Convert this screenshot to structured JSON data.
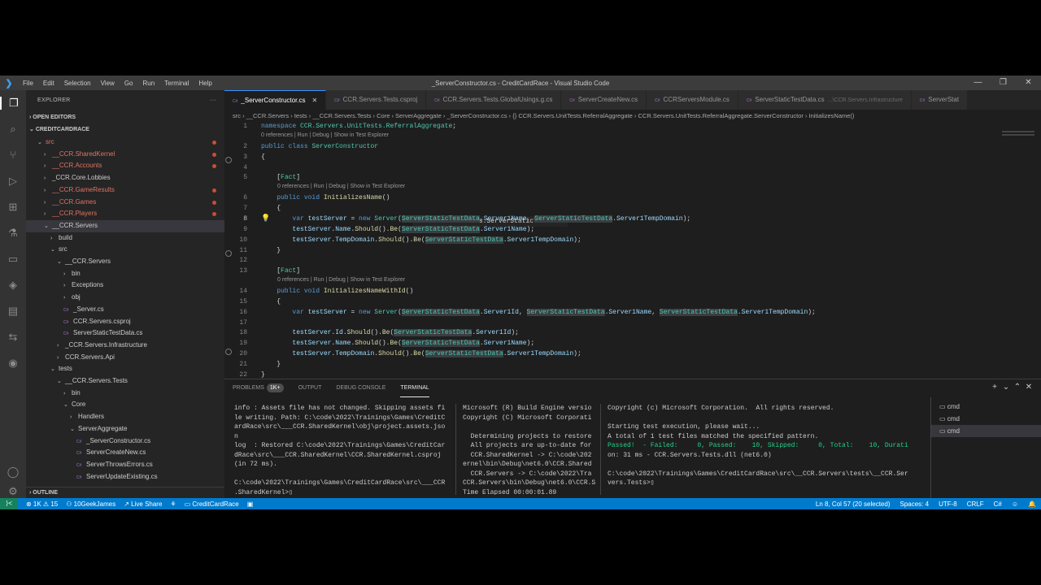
{
  "window": {
    "title": "_ServerConstructor.cs - CreditCardRace - Visual Studio Code",
    "menu": [
      "File",
      "Edit",
      "Selection",
      "View",
      "Go",
      "Run",
      "Terminal",
      "Help"
    ],
    "controls": [
      "—",
      "❐",
      "✕"
    ]
  },
  "sidebar": {
    "title": "EXPLORER",
    "open_editors": "OPEN EDITORS",
    "workspace": "CREDITCARDRACE",
    "outline": "OUTLINE",
    "tree": [
      {
        "label": "src",
        "indent": 1,
        "chev": "⌄",
        "color": "red",
        "dot": true
      },
      {
        "label": "__CCR.SharedKernel",
        "indent": 2,
        "chev": "›",
        "color": "red",
        "dot": true
      },
      {
        "label": "__CCR.Accounts",
        "indent": 2,
        "chev": "›",
        "color": "red",
        "dot": true
      },
      {
        "label": "_CCR.Core.Lobbies",
        "indent": 2,
        "chev": "›",
        "color": "",
        "dot": false
      },
      {
        "label": "__CCR.GameResults",
        "indent": 2,
        "chev": "›",
        "color": "red",
        "dot": true
      },
      {
        "label": "__CCR.Games",
        "indent": 2,
        "chev": "›",
        "color": "red",
        "dot": true
      },
      {
        "label": "__CCR.Players",
        "indent": 2,
        "chev": "›",
        "color": "red",
        "dot": true
      },
      {
        "label": "__CCR.Servers",
        "indent": 2,
        "chev": "⌄",
        "color": "",
        "dot": false,
        "selected": true
      },
      {
        "label": "build",
        "indent": 3,
        "chev": "›",
        "color": "",
        "dot": false
      },
      {
        "label": "src",
        "indent": 3,
        "chev": "⌄",
        "color": "",
        "dot": false
      },
      {
        "label": "__CCR.Servers",
        "indent": 4,
        "chev": "⌄",
        "color": "",
        "dot": false
      },
      {
        "label": "bin",
        "indent": 5,
        "chev": "›",
        "color": "",
        "dot": false
      },
      {
        "label": "Exceptions",
        "indent": 5,
        "chev": "›",
        "color": "",
        "dot": false
      },
      {
        "label": "obj",
        "indent": 5,
        "chev": "›",
        "color": "",
        "dot": false
      },
      {
        "label": "_Server.cs",
        "indent": 5,
        "chev": "",
        "color": "cs",
        "dot": false
      },
      {
        "label": "CCR.Servers.csproj",
        "indent": 5,
        "chev": "",
        "color": "cs",
        "dot": false
      },
      {
        "label": "ServerStaticTestData.cs",
        "indent": 5,
        "chev": "",
        "color": "cs",
        "dot": false
      },
      {
        "label": "_CCR.Servers.Infrastructure",
        "indent": 4,
        "chev": "›",
        "color": "",
        "dot": false
      },
      {
        "label": "CCR.Servers.Api",
        "indent": 4,
        "chev": "›",
        "color": "",
        "dot": false
      },
      {
        "label": "tests",
        "indent": 3,
        "chev": "⌄",
        "color": "",
        "dot": false
      },
      {
        "label": "__CCR.Servers.Tests",
        "indent": 4,
        "chev": "⌄",
        "color": "",
        "dot": false
      },
      {
        "label": "bin",
        "indent": 5,
        "chev": "›",
        "color": "",
        "dot": false
      },
      {
        "label": "Core",
        "indent": 5,
        "chev": "⌄",
        "color": "",
        "dot": false
      },
      {
        "label": "Handlers",
        "indent": 6,
        "chev": "›",
        "color": "",
        "dot": false
      },
      {
        "label": "ServerAggregate",
        "indent": 6,
        "chev": "⌄",
        "color": "",
        "dot": false
      },
      {
        "label": "_ServerConstructor.cs",
        "indent": 7,
        "chev": "",
        "color": "cs",
        "dot": false
      },
      {
        "label": "ServerCreateNew.cs",
        "indent": 7,
        "chev": "",
        "color": "cs",
        "dot": false
      },
      {
        "label": "ServerThrowsErrors.cs",
        "indent": 7,
        "chev": "",
        "color": "cs",
        "dot": false
      },
      {
        "label": "ServerUpdateExisting.cs",
        "indent": 7,
        "chev": "",
        "color": "cs",
        "dot": false
      }
    ]
  },
  "editor": {
    "tabs": [
      {
        "label": "_ServerConstructor.cs",
        "active": true,
        "suffix": ""
      },
      {
        "label": "CCR.Servers.Tests.csproj",
        "active": false,
        "suffix": ""
      },
      {
        "label": "CCR.Servers.Tests.GlobalUsings.g.cs",
        "active": false,
        "suffix": ""
      },
      {
        "label": "ServerCreateNew.cs",
        "active": false,
        "suffix": ""
      },
      {
        "label": "CCRServersModule.cs",
        "active": false,
        "suffix": ""
      },
      {
        "label": "ServerStaticTestData.cs",
        "active": false,
        "suffix": "...\\CCR.Servers.Infrastructure"
      },
      {
        "label": "ServerStat",
        "active": false,
        "suffix": ""
      }
    ],
    "breadcrumbs": "src  ›  __CCR.Servers  ›  tests  ›  __CCR.Servers.Tests  ›  Core  ›  ServerAggregate  ›  _ServerConstructor.cs  ›  {} CCR.Servers.UnitTests.ReferralAggregate  ›  CCR.Servers.UnitTests.ReferralAggregate.ServerConstructor  ›  InitializesName()",
    "lens": "0 references | Run | Debug | Show in Test Explorer",
    "hover": "class CCR.Servers.ServerStaticTestData",
    "line_numbers": [
      "1",
      "2",
      "3",
      "4",
      "5",
      "6",
      "7",
      "8",
      "9",
      "10",
      "11",
      "12",
      "13",
      "14",
      "15",
      "16",
      "17",
      "18",
      "19",
      "20",
      "21",
      "22"
    ]
  },
  "panel": {
    "tabs": [
      {
        "label": "PROBLEMS",
        "badge": "1K+",
        "active": false
      },
      {
        "label": "OUTPUT",
        "badge": "",
        "active": false
      },
      {
        "label": "DEBUG CONSOLE",
        "badge": "",
        "active": false
      },
      {
        "label": "TERMINAL",
        "badge": "",
        "active": true
      }
    ],
    "controls": [
      "+",
      "⌄",
      "⌃",
      "✕"
    ],
    "term1": "info : Assets file has not changed. Skipping assets fi\nle writing. Path: C:\\code\\2022\\Trainings\\Games\\CreditC\nardRace\\src\\___CCR.SharedKernel\\obj\\project.assets.jso\nn\nlog  : Restored C:\\code\\2022\\Trainings\\Games\\CreditCar\ndRace\\src\\___CCR.SharedKernel\\CCR.SharedKernel.csproj\n(in 72 ms).\n\nC:\\code\\2022\\Trainings\\Games\\CreditCardRace\\src\\___CCR\n.SharedKernel>▯",
    "term2": "Microsoft (R) Build Engine versio\nCopyright (C) Microsoft Corporati\n\n  Determining projects to restore\n  All projects are up-to-date for\n  CCR.SharedKernel -> C:\\code\\202\nernel\\bin\\Debug\\net6.0\\CCR.Shared\n  CCR.Servers -> C:\\code\\2022\\Tra\nCCR.Servers\\bin\\Debug\\net6.0\\CCR.S\nTime Elapsed 00:00:01.89",
    "term3_a": "Copyright (c) Microsoft Corporation.  All rights reserved.\n\nStarting test execution, please wait...\nA total of 1 test files matched the specified pattern.\n",
    "term3_b": "Passed!  - Failed:     0, Passed:    10, Skipped:     0, Total:    10, Durati",
    "term3_c": "on: 31 ms - CCR.Servers.Tests.dll (net6.0)\n\nC:\\code\\2022\\Trainings\\Games\\CreditCardRace\\src\\__CCR.Servers\\tests\\__CCR.Ser\nvers.Tests>▯",
    "terminals": [
      "cmd",
      "cmd",
      "cmd"
    ]
  },
  "status": {
    "remote": "⟩<",
    "errors": "⊗ 1K  ⚠ 15",
    "user": "10GeekJames",
    "liveshare": "Live Share",
    "project": "CreditCardRace",
    "position": "Ln 8, Col 57 (20 selected)",
    "spaces": "Spaces: 4",
    "encoding": "UTF-8",
    "eol": "CRLF",
    "language": "C#"
  }
}
